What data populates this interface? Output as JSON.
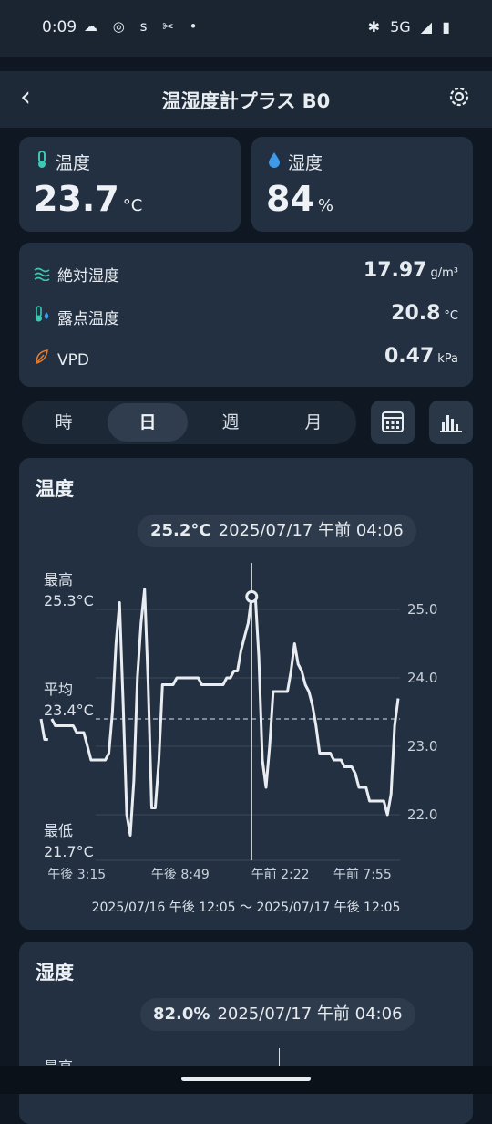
{
  "status_bar": {
    "time": "0:09",
    "network": "5G"
  },
  "app_bar": {
    "title": "温湿度計プラス B0"
  },
  "temperature_card": {
    "label": "温度",
    "value": "23.7",
    "unit": "°C"
  },
  "humidity_card": {
    "label": "湿度",
    "value": "84",
    "unit": "%"
  },
  "details": [
    {
      "label": "絶対湿度",
      "value": "17.97",
      "unit": "g/m³",
      "icon": "wave-icon"
    },
    {
      "label": "露点温度",
      "value": "20.8",
      "unit": "°C",
      "icon": "dewpoint-icon"
    },
    {
      "label": "VPD",
      "value": "0.47",
      "unit": "kPa",
      "icon": "leaf-icon"
    }
  ],
  "period_tabs": [
    "時",
    "日",
    "週",
    "月"
  ],
  "selected_tab": "日",
  "temp_chart": {
    "title": "温度",
    "selected_value": "25.2°C",
    "selected_time": "2025/07/17 午前 04:06",
    "max_label": "最高",
    "max_value": "25.3°C",
    "avg_label": "平均",
    "avg_value": "23.4°C",
    "min_label": "最低",
    "min_value": "21.7°C",
    "range_text": "2025/07/16 午後 12:05 ～ 2025/07/17 午後 12:05"
  },
  "humidity_chart": {
    "title": "湿度",
    "selected_value": "82.0%",
    "selected_time": "2025/07/17 午前 04:06",
    "max_label": "最高"
  },
  "chart_data": {
    "type": "line",
    "title": "温度",
    "x_tick_labels": [
      "午後 3:15",
      "午後 8:49",
      "午前 2:22",
      "午前 7:55"
    ],
    "y_tick_labels": [
      "25.0",
      "24.0",
      "23.0",
      "22.0"
    ],
    "ylim": [
      21.7,
      25.3
    ],
    "average": 23.4,
    "selected_point": {
      "value": 25.2,
      "time": "2025/07/17 午前 04:06"
    },
    "x_range": [
      "2025/07/16 午後 12:05",
      "2025/07/17 午後 12:05"
    ],
    "series": [
      {
        "values": [
          23.4,
          23.1,
          23.1,
          23.4,
          23.3,
          23.3,
          23.3,
          23.3,
          23.3,
          23.3,
          23.2,
          23.2,
          23.2,
          23.0,
          22.8,
          22.8,
          22.8,
          22.8,
          22.8,
          22.9,
          23.5,
          24.5,
          25.1,
          23.6,
          22.0,
          21.7,
          22.5,
          24.0,
          24.8,
          25.3,
          23.9,
          22.1,
          22.1,
          22.8,
          23.9,
          23.9,
          23.9,
          23.9,
          24.0,
          24.0,
          24.0,
          24.0,
          24.0,
          24.0,
          24.0,
          23.9,
          23.9,
          23.9,
          23.9,
          23.9,
          23.9,
          23.9,
          24.0,
          24.0,
          24.1,
          24.1,
          24.4,
          24.6,
          24.8,
          25.2,
          25.2,
          24.3,
          22.8,
          22.4,
          23.0,
          23.8,
          23.8,
          23.8,
          23.8,
          23.8,
          24.1,
          24.5,
          24.2,
          24.1,
          23.9,
          23.8,
          23.6,
          23.3,
          22.9,
          22.9,
          22.9,
          22.9,
          22.8,
          22.8,
          22.8,
          22.7,
          22.7,
          22.7,
          22.6,
          22.4,
          22.4,
          22.4,
          22.2,
          22.2,
          22.2,
          22.2,
          22.2,
          22.0,
          22.3,
          23.3,
          23.7
        ]
      }
    ]
  },
  "colors": {
    "background": "#0f1822",
    "card": "#233041",
    "line": "#e9edf1",
    "temp_icon": "#3fc7b6",
    "humidity_icon": "#3d9be9",
    "vpd_icon": "#e07b2f"
  }
}
